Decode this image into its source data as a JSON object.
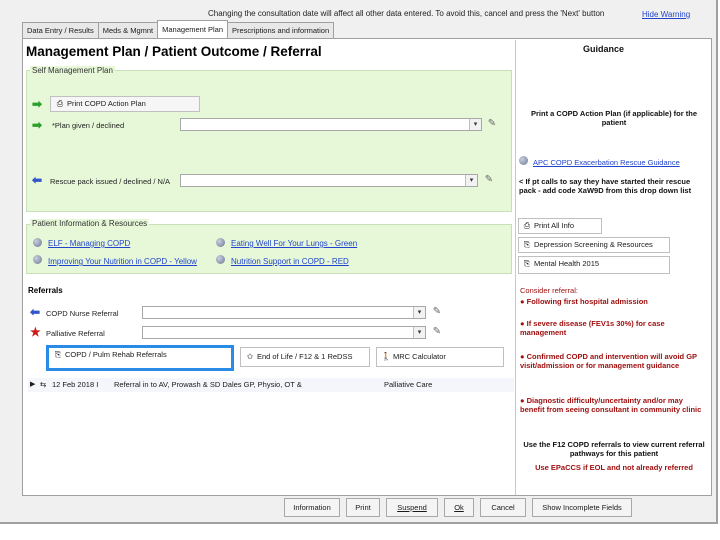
{
  "header": {
    "notice": "Changing the consultation date will affect all other data entered. To avoid this, cancel and press the 'Next' button",
    "hide_warning": "Hide Warning"
  },
  "tabs": [
    {
      "label": "Data Entry / Results",
      "active": false
    },
    {
      "label": "Meds & Mgmnt",
      "active": false
    },
    {
      "label": "Management Plan",
      "active": true
    },
    {
      "label": "Prescriptions and information",
      "active": false
    }
  ],
  "page_title": "Management Plan / Patient Outcome / Referral",
  "self_management": {
    "group_label": "Self Management Plan",
    "print_button": "Print COPD Action Plan",
    "plan_given_label": "*Plan given / declined",
    "rescue_label": "Rescue pack issued / declined / N/A"
  },
  "patient_info": {
    "group_label": "Patient Information & Resources",
    "links": [
      "ELF - Managing COPD",
      "Improving Your Nutrition in COPD - Yellow",
      "Eating Well For Your Lungs - Green",
      "Nutrition Support in COPD - RED"
    ]
  },
  "referrals": {
    "heading": "Referrals",
    "nurse_label": "COPD Nurse Referral",
    "palliative_label": "Palliative Referral",
    "tiles": {
      "rehab": "COPD / Pulm Rehab Referrals",
      "eol": "End of Life / F12 & 1 ReDSS",
      "mrc": "MRC Calculator"
    },
    "list_row": {
      "date": "12 Feb 2018 I",
      "text": "Referral in to AV, Prowash & SD Dales GP, Physio, OT &",
      "service": "Palliative Care"
    }
  },
  "guidance": {
    "heading": "Guidance",
    "print_note": "Print a COPD Action Plan (if applicable) for the patient",
    "exacerbation_link": "APC COPD Exacerbation Rescue Guidance",
    "rescue_note": "< If pt calls to say they have started their rescue pack - add code XaW9D from this drop down list",
    "buttons": [
      "Print All Info",
      "Depression Screening & Resources",
      "Mental Health 2015"
    ],
    "consider_heading": "Consider referral:",
    "bullets": [
      "● Following first hospital admission",
      "● If severe disease (FEV1s 30%) for case management",
      "● Confirmed COPD and intervention will avoid GP visit/admission or for management guidance",
      "● Diagnostic difficulty/uncertainty and/or may benefit from seeing consultant in community clinic"
    ],
    "footer_note": "Use the F12 COPD referrals to view current referral pathways for this patient",
    "epacs_note": "Use EPaCCS if EOL and not already referred"
  },
  "bottom_buttons": {
    "information": "Information",
    "print": "Print",
    "suspend": "Suspend",
    "ok": "Ok",
    "cancel": "Cancel",
    "show_incomplete": "Show Incomplete Fields"
  },
  "colors": {
    "panel_green": "#e7f8d8",
    "link_blue": "#2244cc",
    "guidance_red": "#a01010",
    "selection_blue": "#2a8ae8",
    "arrow_green": "#2aa02a",
    "arrow_blue": "#3355cc",
    "star_red": "#cc1a1a"
  }
}
